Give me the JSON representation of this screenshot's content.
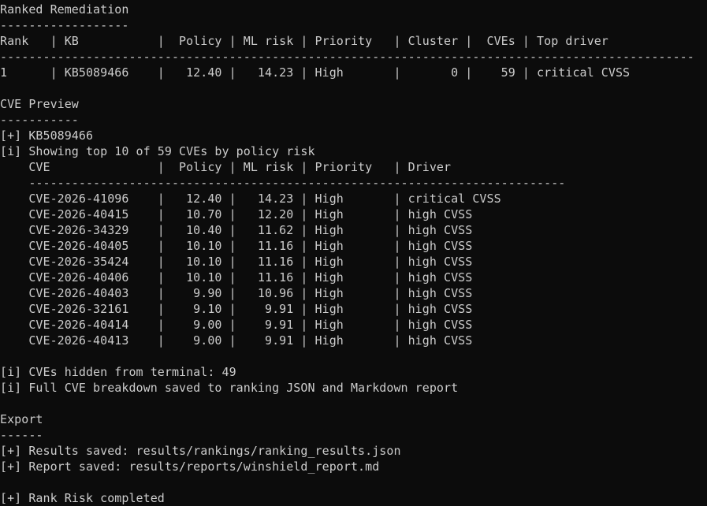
{
  "terminal": {
    "lines": [
      {
        "row": 0,
        "name": "section-title-ranked-remediation",
        "text": "Ranked Remediation"
      },
      {
        "row": 1,
        "name": "section-underline",
        "text": "------------------"
      },
      {
        "row": 2,
        "name": "ranking-table-header",
        "text": "Rank   | KB           |  Policy | ML risk | Priority   | Cluster |  CVEs | Top driver"
      },
      {
        "row": 3,
        "name": "ranking-table-divider",
        "text": "-------------------------------------------------------------------------------------------------"
      },
      {
        "row": 4,
        "name": "ranking-table-row",
        "text": "1      | KB5089466    |   12.40 |   14.23 | High       |       0 |    59 | critical CVSS"
      },
      {
        "row": 6,
        "name": "section-title-cve-preview",
        "text": "CVE Preview"
      },
      {
        "row": 7,
        "name": "section-underline",
        "text": "-----------"
      },
      {
        "row": 8,
        "name": "kb-heading",
        "text": "[+] KB5089466"
      },
      {
        "row": 9,
        "name": "info-line-showing-top",
        "text": "[i] Showing top 10 of 59 CVEs by policy risk"
      },
      {
        "row": 10,
        "name": "cve-table-header",
        "text": "    CVE               |  Policy | ML risk | Priority   | Driver"
      },
      {
        "row": 11,
        "name": "cve-table-divider",
        "text": "    ---------------------------------------------------------------------------"
      },
      {
        "row": 12,
        "name": "cve-table-row",
        "text": "    CVE-2026-41096    |   12.40 |   14.23 | High       | critical CVSS"
      },
      {
        "row": 13,
        "name": "cve-table-row",
        "text": "    CVE-2026-40415    |   10.70 |   12.20 | High       | high CVSS"
      },
      {
        "row": 14,
        "name": "cve-table-row",
        "text": "    CVE-2026-34329    |   10.40 |   11.62 | High       | high CVSS"
      },
      {
        "row": 15,
        "name": "cve-table-row",
        "text": "    CVE-2026-40405    |   10.10 |   11.16 | High       | high CVSS"
      },
      {
        "row": 16,
        "name": "cve-table-row",
        "text": "    CVE-2026-35424    |   10.10 |   11.16 | High       | high CVSS"
      },
      {
        "row": 17,
        "name": "cve-table-row",
        "text": "    CVE-2026-40406    |   10.10 |   11.16 | High       | high CVSS"
      },
      {
        "row": 18,
        "name": "cve-table-row",
        "text": "    CVE-2026-40403    |    9.90 |   10.96 | High       | high CVSS"
      },
      {
        "row": 19,
        "name": "cve-table-row",
        "text": "    CVE-2026-32161    |    9.10 |    9.91 | High       | high CVSS"
      },
      {
        "row": 20,
        "name": "cve-table-row",
        "text": "    CVE-2026-40414    |    9.00 |    9.91 | High       | high CVSS"
      },
      {
        "row": 21,
        "name": "cve-table-row",
        "text": "    CVE-2026-40413    |    9.00 |    9.91 | High       | high CVSS"
      },
      {
        "row": 23,
        "name": "info-line-hidden-cves",
        "text": "[i] CVEs hidden from terminal: 49"
      },
      {
        "row": 24,
        "name": "info-line-full-breakdown",
        "text": "[i] Full CVE breakdown saved to ranking JSON and Markdown report"
      },
      {
        "row": 26,
        "name": "section-title-export",
        "text": "Export"
      },
      {
        "row": 27,
        "name": "section-underline",
        "text": "------"
      },
      {
        "row": 28,
        "name": "status-line-results-saved",
        "text": "[+] Results saved: results/rankings/ranking_results.json"
      },
      {
        "row": 29,
        "name": "status-line-report-saved",
        "text": "[+] Report saved: results/reports/winshield_report.md"
      },
      {
        "row": 31,
        "name": "status-line-rank-risk-completed",
        "text": "[+] Rank Risk completed"
      }
    ]
  },
  "colors": {
    "background": "#0c0c0c",
    "foreground": "#cccccc"
  }
}
